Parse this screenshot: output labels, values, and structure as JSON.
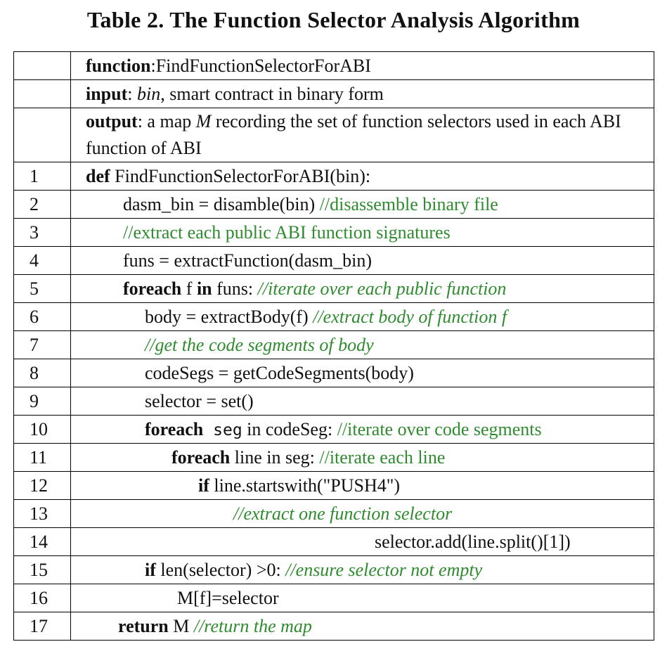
{
  "title": "Table 2. The Function Selector Analysis Algorithm",
  "header": {
    "function_kw": "function",
    "function_rest": ":FindFunctionSelectorForABI",
    "input_kw": "input",
    "input_colon": ": ",
    "input_var": "bin",
    "input_rest": ", smart contract in binary form",
    "output_kw": "output",
    "output_a": ": a map ",
    "output_var": "M",
    "output_rest": " recording the set of function selectors used in each ABI function of ABI"
  },
  "lines": [
    {
      "num": "1",
      "kw": "def",
      "code": " FindFunctionSelectorForABI(bin):"
    },
    {
      "num": "2",
      "code": "dasm_bin = disamble(bin) ",
      "comment": "//disassemble binary file"
    },
    {
      "num": "3",
      "comment": "//extract each public ABI function signatures"
    },
    {
      "num": "4",
      "code": "funs  = extractFunction(dasm_bin)"
    },
    {
      "num": "5",
      "kw": "foreach",
      "code_a": " f ",
      "kw2": "in",
      "code_b": " funs: ",
      "comment": "//iterate over each public function"
    },
    {
      "num": "6",
      "code": "body = extractBody(f) ",
      "comment": "//extract body of function f"
    },
    {
      "num": "7",
      "comment": "//get the code segments of body"
    },
    {
      "num": "8",
      "code": "codeSegs = getCodeSegments(body)"
    },
    {
      "num": "9",
      "code": "selector = set()"
    },
    {
      "num": "10",
      "kw": "foreach",
      "mono": " seg",
      "code": " in codeSeg: ",
      "comment": "//iterate over code segments"
    },
    {
      "num": "11",
      "kw": "foreach",
      "code": " line in seg:  ",
      "comment": "//iterate each line"
    },
    {
      "num": "12",
      "kw": "if",
      "code": " line.startswith(\"PUSH4\")"
    },
    {
      "num": "13",
      "comment": "//extract one function selector"
    },
    {
      "num": "14",
      "code": "selector.add(line.split()[1])"
    },
    {
      "num": "15",
      "kw": "if",
      "code": " len(selector) >0: ",
      "comment": "//ensure selector not empty"
    },
    {
      "num": "16",
      "code": "M[f]=selector"
    },
    {
      "num": "17",
      "kw": "return",
      "code": " M ",
      "comment": "//return the map"
    }
  ]
}
